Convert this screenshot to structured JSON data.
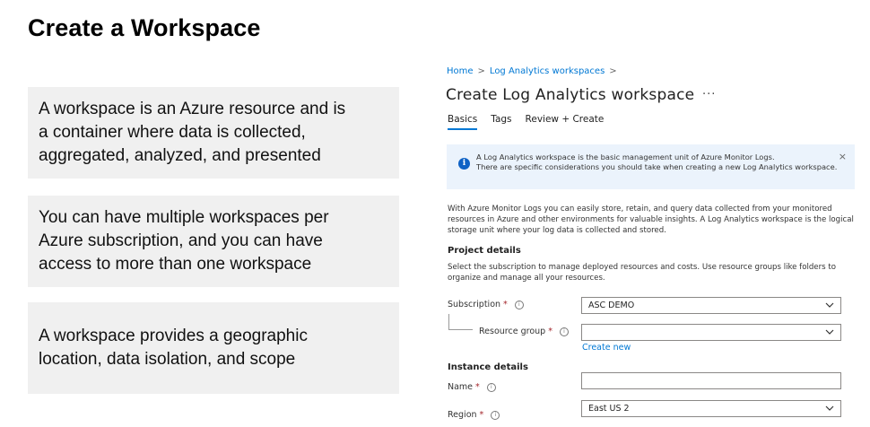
{
  "slide": {
    "title": "Create a Workspace",
    "points": [
      "A workspace is an Azure resource and is a container where data is collected, aggregated, analyzed, and presented",
      "You can have multiple workspaces per Azure subscription, and you can have access to more than one workspace",
      "A workspace provides a geographic location, data isolation, and scope"
    ]
  },
  "portal": {
    "breadcrumb": [
      "Home",
      "Log Analytics workspaces"
    ],
    "title": "Create Log Analytics workspace",
    "more": "···",
    "tabs": [
      "Basics",
      "Tags",
      "Review + Create"
    ],
    "active_tab": "Basics",
    "banner": {
      "line1": "A Log Analytics workspace is the basic management unit of Azure Monitor Logs.",
      "line2": "There are specific considerations you should take when creating a new Log Analytics workspace."
    },
    "description": "With Azure Monitor Logs you can easily store, retain, and query data collected from your monitored resources in Azure and other environments for valuable insights. A Log Analytics workspace is the logical storage unit where your log data is collected and stored.",
    "project_details": {
      "heading": "Project details",
      "description": "Select the subscription to manage deployed resources and costs. Use resource groups like folders to organize and manage all your resources.",
      "subscription_label": "Subscription",
      "subscription_value": "ASC DEMO",
      "resource_group_label": "Resource group",
      "resource_group_value": "",
      "create_new": "Create new"
    },
    "instance_details": {
      "heading": "Instance details",
      "name_label": "Name",
      "name_value": "",
      "region_label": "Region",
      "region_value": "East US 2"
    },
    "required_marker": "*",
    "help_glyph": "i",
    "close_glyph": "×",
    "info_glyph": "i",
    "chevron_glyph": ">"
  },
  "colors": {
    "link": "#0078d4",
    "banner_bg": "#ebf3fc",
    "box_bg": "#f0f0f0",
    "info_icon": "#0f62c5",
    "required": "#a4262c"
  }
}
